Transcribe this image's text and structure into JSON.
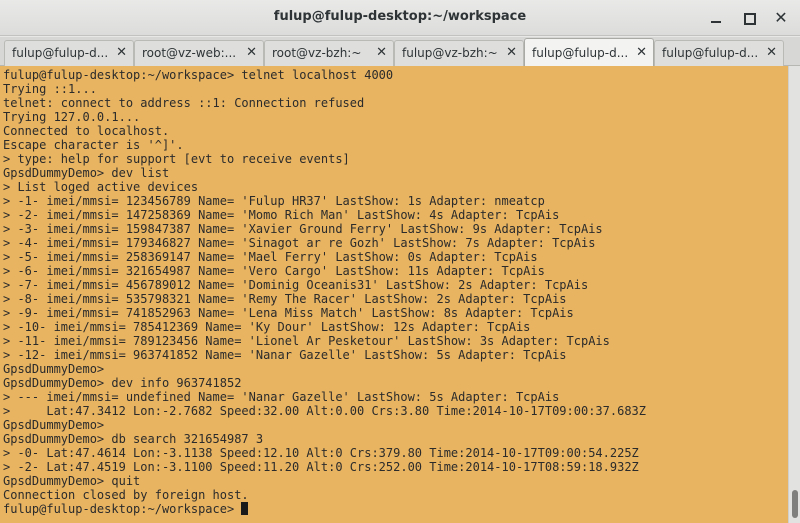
{
  "window": {
    "title": "fulup@fulup-desktop:~/workspace"
  },
  "tabs": [
    {
      "label": "fulup@fulup-d...",
      "active": false
    },
    {
      "label": "root@vz-web:...",
      "active": false
    },
    {
      "label": "root@vz-bzh:~",
      "active": false
    },
    {
      "label": "fulup@vz-bzh:~",
      "active": false
    },
    {
      "label": "fulup@fulup-d...",
      "active": true
    },
    {
      "label": "fulup@fulup-d...",
      "active": false
    }
  ],
  "tab_close_glyph": "✕",
  "close_glyph": "✕",
  "terminal": {
    "lines": [
      "fulup@fulup-desktop:~/workspace> telnet localhost 4000",
      "Trying ::1...",
      "telnet: connect to address ::1: Connection refused",
      "Trying 127.0.0.1...",
      "Connected to localhost.",
      "Escape character is '^]'.",
      "> type: help for support [evt to receive events]",
      "GpsdDummyDemo> dev list",
      "> List loged active devices",
      "> -1- imei/mmsi= 123456789 Name= 'Fulup HR37' LastShow: 1s Adapter: nmeatcp",
      "> -2- imei/mmsi= 147258369 Name= 'Momo Rich Man' LastShow: 4s Adapter: TcpAis",
      "> -3- imei/mmsi= 159847387 Name= 'Xavier Ground Ferry' LastShow: 9s Adapter: TcpAis",
      "> -4- imei/mmsi= 179346827 Name= 'Sinagot ar re Gozh' LastShow: 7s Adapter: TcpAis",
      "> -5- imei/mmsi= 258369147 Name= 'Mael Ferry' LastShow: 0s Adapter: TcpAis",
      "> -6- imei/mmsi= 321654987 Name= 'Vero Cargo' LastShow: 11s Adapter: TcpAis",
      "> -7- imei/mmsi= 456789012 Name= 'Dominig Oceanis31' LastShow: 2s Adapter: TcpAis",
      "> -8- imei/mmsi= 535798321 Name= 'Remy The Racer' LastShow: 2s Adapter: TcpAis",
      "> -9- imei/mmsi= 741852963 Name= 'Lena Miss Match' LastShow: 8s Adapter: TcpAis",
      "> -10- imei/mmsi= 785412369 Name= 'Ky Dour' LastShow: 12s Adapter: TcpAis",
      "> -11- imei/mmsi= 789123456 Name= 'Lionel Ar Pesketour' LastShow: 3s Adapter: TcpAis",
      "> -12- imei/mmsi= 963741852 Name= 'Nanar Gazelle' LastShow: 5s Adapter: TcpAis",
      "GpsdDummyDemo>",
      "GpsdDummyDemo> dev info 963741852",
      "> --- imei/mmsi= undefined Name= 'Nanar Gazelle' LastShow: 5s Adapter: TcpAis",
      ">     Lat:47.3412 Lon:-2.7682 Speed:32.00 Alt:0.00 Crs:3.80 Time:2014-10-17T09:00:37.683Z",
      "GpsdDummyDemo>",
      "GpsdDummyDemo> db search 321654987 3",
      "> -0- Lat:47.4614 Lon:-3.1138 Speed:12.10 Alt:0 Crs:379.80 Time:2014-10-17T09:00:54.225Z",
      "> -2- Lat:47.4519 Lon:-3.1100 Speed:11.20 Alt:0 Crs:252.00 Time:2014-10-17T08:59:18.932Z",
      "GpsdDummyDemo> quit",
      "Connection closed by foreign host."
    ],
    "prompt": "fulup@fulup-desktop:~/workspace> "
  }
}
